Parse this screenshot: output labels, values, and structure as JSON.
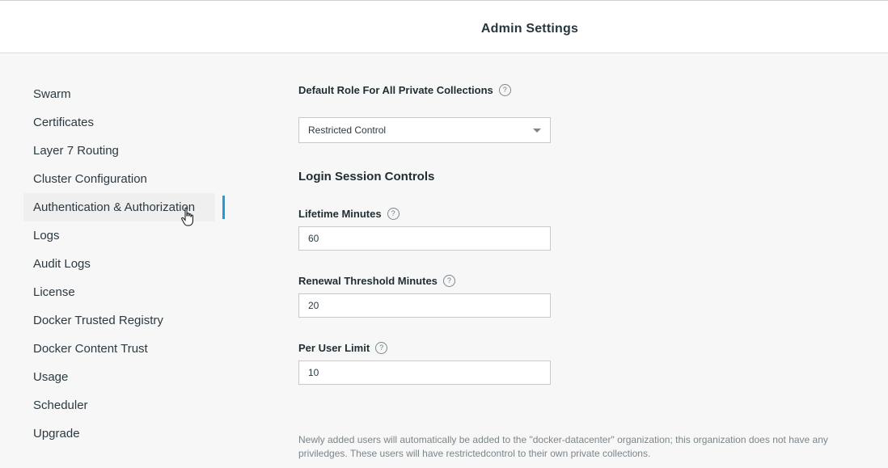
{
  "header": {
    "title": "Admin Settings"
  },
  "sidebar": {
    "items": [
      {
        "label": "Swarm"
      },
      {
        "label": "Certificates"
      },
      {
        "label": "Layer 7 Routing"
      },
      {
        "label": "Cluster Configuration"
      },
      {
        "label": "Authentication & Authorization",
        "active": true
      },
      {
        "label": "Logs"
      },
      {
        "label": "Audit Logs"
      },
      {
        "label": "License"
      },
      {
        "label": "Docker Trusted Registry"
      },
      {
        "label": "Docker Content Trust"
      },
      {
        "label": "Usage"
      },
      {
        "label": "Scheduler"
      },
      {
        "label": "Upgrade"
      }
    ]
  },
  "main": {
    "default_role": {
      "label": "Default Role For All Private Collections",
      "selected": "Restricted Control"
    },
    "session_controls_title": "Login Session Controls",
    "lifetime": {
      "label": "Lifetime Minutes",
      "value": "60"
    },
    "renewal": {
      "label": "Renewal Threshold Minutes",
      "value": "20"
    },
    "per_user": {
      "label": "Per User Limit",
      "value": "10"
    },
    "note": "Newly added users will automatically be added to the \"docker-datacenter\" organization; this organization does not have any priviledges. These users will have restrictedcontrol to their own private collections."
  },
  "colors": {
    "accent": "#1e9ed8",
    "background": "#f7f7f7"
  },
  "help_glyph": "?"
}
